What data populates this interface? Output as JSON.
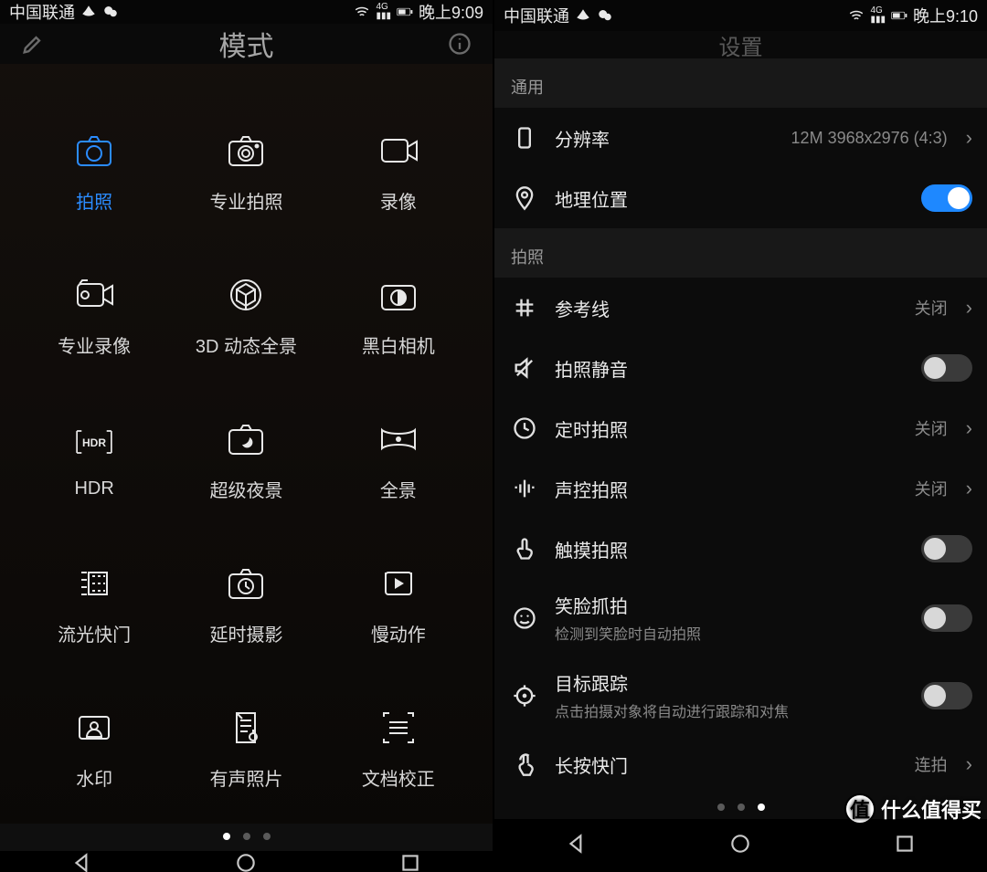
{
  "left": {
    "status": {
      "carrier": "中国联通",
      "time": "晚上9:09"
    },
    "header": {
      "title": "模式"
    },
    "modes": [
      {
        "id": "photo",
        "label": "拍照",
        "active": true
      },
      {
        "id": "pro-photo",
        "label": "专业拍照",
        "active": false
      },
      {
        "id": "video",
        "label": "录像",
        "active": false
      },
      {
        "id": "pro-video",
        "label": "专业录像",
        "active": false
      },
      {
        "id": "3d-pano",
        "label": "3D 动态全景",
        "active": false
      },
      {
        "id": "mono",
        "label": "黑白相机",
        "active": false
      },
      {
        "id": "hdr",
        "label": "HDR",
        "active": false
      },
      {
        "id": "night",
        "label": "超级夜景",
        "active": false
      },
      {
        "id": "pano",
        "label": "全景",
        "active": false
      },
      {
        "id": "light",
        "label": "流光快门",
        "active": false
      },
      {
        "id": "timelapse",
        "label": "延时摄影",
        "active": false
      },
      {
        "id": "slomo",
        "label": "慢动作",
        "active": false
      },
      {
        "id": "watermark",
        "label": "水印",
        "active": false
      },
      {
        "id": "audio-photo",
        "label": "有声照片",
        "active": false
      },
      {
        "id": "doc-scan",
        "label": "文档校正",
        "active": false
      }
    ],
    "dots": {
      "count": 3,
      "active": 0
    }
  },
  "right": {
    "status": {
      "carrier": "中国联通",
      "time": "晚上9:10"
    },
    "header": {
      "title": "设置"
    },
    "sections": {
      "general": {
        "header": "通用",
        "resolution": {
          "label": "分辨率",
          "value": "12M 3968x2976 (4:3)"
        },
        "location": {
          "label": "地理位置",
          "on": true
        }
      },
      "photo": {
        "header": "拍照",
        "grid": {
          "label": "参考线",
          "value": "关闭"
        },
        "mute": {
          "label": "拍照静音",
          "on": false
        },
        "timer": {
          "label": "定时拍照",
          "value": "关闭"
        },
        "voice": {
          "label": "声控拍照",
          "value": "关闭"
        },
        "touch": {
          "label": "触摸拍照",
          "on": false
        },
        "smile": {
          "label": "笑脸抓拍",
          "sub": "检测到笑脸时自动拍照",
          "on": false
        },
        "track": {
          "label": "目标跟踪",
          "sub": "点击拍摄对象将自动进行跟踪和对焦",
          "on": false
        },
        "hold": {
          "label": "长按快门",
          "value": "连拍"
        }
      }
    },
    "dots": {
      "count": 3,
      "active": 2
    }
  },
  "watermark": "什么值得买"
}
